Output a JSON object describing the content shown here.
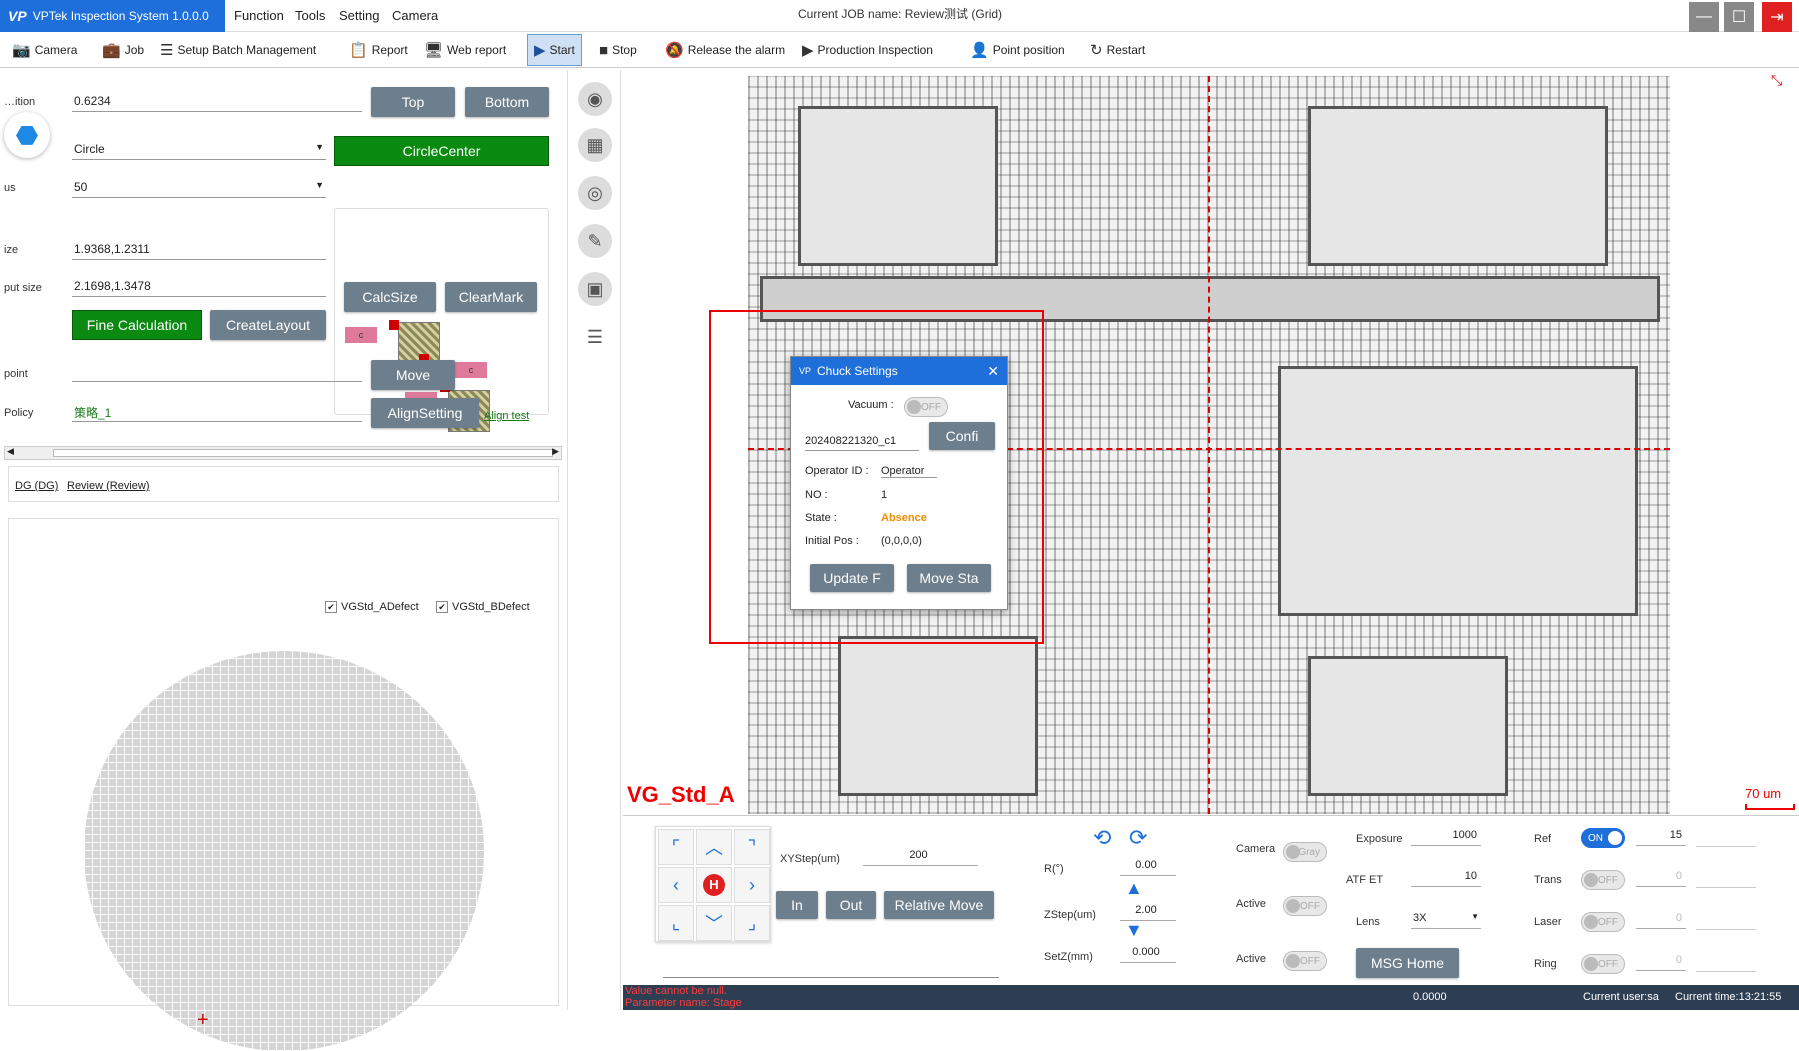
{
  "app": {
    "title": "VPTek Inspection System 1.0.0.0",
    "logo": "VP",
    "job_label": "Current JOB name:  Review测试 (Grid)"
  },
  "menu": [
    "Function",
    "Tools",
    "Setting",
    "Camera"
  ],
  "toolbar": [
    "Camera",
    "Job",
    "Setup Batch Management",
    "Report",
    "Web report",
    "Start",
    "Stop",
    "Release the alarm",
    "Production Inspection",
    "Point position",
    "Restart"
  ],
  "left": {
    "fields": {
      "r1_label": "…ition",
      "r1_value": "0.6234",
      "r2_value": "Circle",
      "r3_label": "us",
      "r3_value": "50",
      "r4_label": "ize",
      "r4_value": "1.9368,1.2311",
      "r5_label": "put size",
      "r5_value": "2.1698,1.3478",
      "r6_label": "point",
      "r6_value": "",
      "r7_label": "Policy",
      "r7_value": "策略_1"
    },
    "buttons": {
      "top": "Top",
      "bottom": "Bottom",
      "circlecenter": "CircleCenter",
      "calcsize": "CalcSize",
      "clearmark": "ClearMark",
      "fine": "Fine Calculation",
      "createlayout": "CreateLayout",
      "move": "Move",
      "alignsetting": "AlignSetting"
    },
    "align_link": "Align test",
    "tabs": [
      "DG (DG)",
      "Review (Review)"
    ],
    "checks": [
      "VGStd_ADefect",
      "VGStd_BDefect"
    ],
    "mini_labels": [
      "c",
      "c",
      "c"
    ]
  },
  "viewer": {
    "overlay_label": "VG_Std_A",
    "scale_label": "70 um"
  },
  "dialog": {
    "title": "Chuck Settings",
    "vacuum_label": "Vacuum :",
    "vacuum_state": "OFF",
    "id_value": "202408221320_c1",
    "confirm": "Confi",
    "operator_label": "Operator ID :",
    "operator_value": "Operator",
    "no_label": "NO :",
    "no_value": "1",
    "state_label": "State :",
    "state_value": "Absence",
    "initpos_label": "Initial Pos :",
    "initpos_value": "(0,0,0,0)",
    "update": "Update F",
    "move": "Move Sta"
  },
  "control": {
    "xystep_label": "XYStep(um)",
    "xystep_value": "200",
    "in": "In",
    "out": "Out",
    "relmove": "Relative Move",
    "r_label": "R(°)",
    "r_value": "0.00",
    "zstep_label": "ZStep(um)",
    "zstep_value": "2.00",
    "setz_label": "SetZ(mm)",
    "setz_value": "0.000",
    "camera_label": "Camera",
    "camera_toggle": "Gray",
    "active1_label": "Active",
    "active1_toggle": "OFF",
    "active2_label": "Active",
    "active2_toggle": "OFF",
    "exposure_label": "Exposure",
    "exposure_value": "1000",
    "atf_label": "ATF ET",
    "atf_value": "10",
    "lens_label": "Lens",
    "lens_value": "3X",
    "msghome": "MSG Home",
    "ref_label": "Ref",
    "ref_toggle": "ON",
    "ref_value": "15",
    "trans_label": "Trans",
    "trans_toggle": "OFF",
    "trans_value": "0",
    "laser_label": "Laser",
    "laser_toggle": "OFF",
    "laser_value": "0",
    "ring_label": "Ring",
    "ring_toggle": "OFF",
    "ring_value": "0",
    "home_glyph": "H"
  },
  "status": {
    "error1": "Value cannot be null.",
    "error2": "Parameter name: Stage",
    "coord": "0.0000",
    "user": "Current user:sa",
    "time": "Current time:13:21:55"
  }
}
